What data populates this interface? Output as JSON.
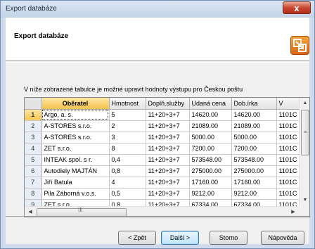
{
  "window": {
    "title": "Export databáze",
    "close_glyph": "x"
  },
  "header": {
    "title": "Export databáze",
    "icon": "export-wizard-icon"
  },
  "instruction": "V níže zobrazené tabulce je možné upravit hodnoty výstupu pro Českou poštu",
  "grid": {
    "columns": [
      "Oběratel",
      "Hmotnost",
      "Doplň.služby",
      "Udaná cena",
      "Dob.írka",
      "V"
    ],
    "rows": [
      {
        "num": "1",
        "cells": [
          "Argo, a. s.",
          "5",
          "11+20+3+7",
          "14620.00",
          "14620.00",
          "1101C"
        ]
      },
      {
        "num": "2",
        "cells": [
          "A-STORES s.r.o.",
          "2",
          "11+20+3+7",
          "21089.00",
          "21089.00",
          "1101C"
        ]
      },
      {
        "num": "3",
        "cells": [
          "A-STORES s.r.o.",
          "3",
          "11+20+3+7",
          "5000.00",
          "5000.00",
          "1101C"
        ]
      },
      {
        "num": "4",
        "cells": [
          "ZET s.r.o.",
          "8",
          "11+20+3+7",
          "7200.00",
          "7200.00",
          "1101C"
        ]
      },
      {
        "num": "5",
        "cells": [
          "INTEAK spol. s r.",
          "0,4",
          "11+20+3+7",
          "573548.00",
          "573548.00",
          "1101C"
        ]
      },
      {
        "num": "6",
        "cells": [
          "Autodiely MAJTÁN",
          "0,8",
          "11+20+3+7",
          "275000.00",
          "275000.00",
          "1101C"
        ]
      },
      {
        "num": "7",
        "cells": [
          "Jiří Batula",
          "4",
          "11+20+3+7",
          "17160.00",
          "17160.00",
          "1101C"
        ]
      },
      {
        "num": "8",
        "cells": [
          "Pila Záborná v.o.s.",
          "0,5",
          "11+20+3+7",
          "9212.00",
          "9212.00",
          "1101C"
        ]
      },
      {
        "num": "9",
        "cells": [
          "ZET s.r.o.",
          "0,8",
          "11+20+3+7",
          "67334.00",
          "67334.00",
          "1101C"
        ]
      }
    ],
    "selected_row": "1",
    "hscroll_grip": "III",
    "vscroll_grip": "≡"
  },
  "buttons": {
    "back": "< Zpět",
    "next": "Další >",
    "cancel": "Storno",
    "help": "Nápověda"
  }
}
